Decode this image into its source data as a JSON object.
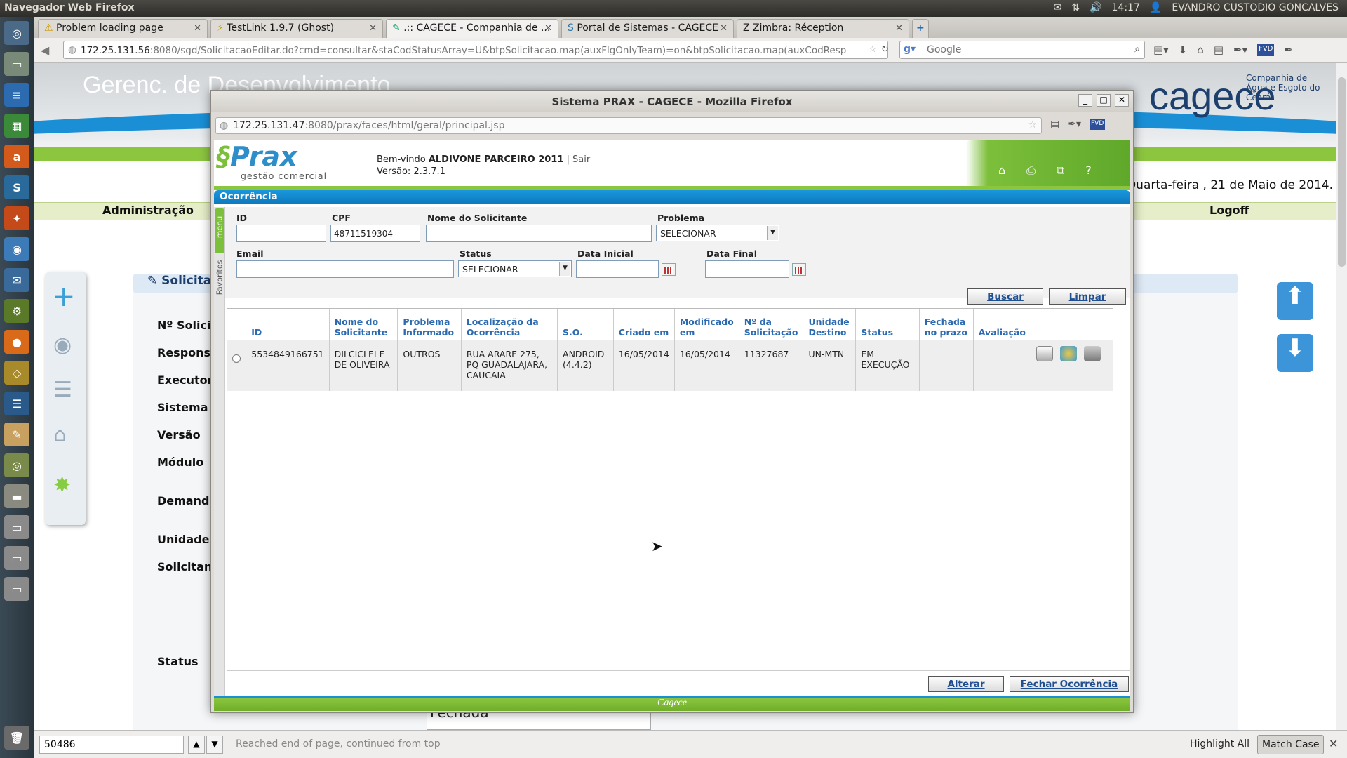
{
  "system": {
    "app_title": "Navegador Web Firefox",
    "clock": "14:17",
    "user": "EVANDRO CUSTODIO GONCALVES"
  },
  "tabs": [
    {
      "label": "Problem loading page"
    },
    {
      "label": "TestLink 1.9.7 (Ghost)"
    },
    {
      "label": ".:: CAGECE - Companhia de ..."
    },
    {
      "label": "Portal de Sistemas - CAGECE"
    },
    {
      "label": "Zimbra: Réception"
    }
  ],
  "browser": {
    "url_host": "172.25.131.56",
    "url_rest": ":8080/sgd/SolicitacaoEditar.do?cmd=consultar&staCodStatusArray=U&btpSolicitacao.map(auxFlgOnlyTeam)=on&btpSolicitacao.map(auxCodResp",
    "search_placeholder": "Google"
  },
  "background": {
    "header_title": "Gerenc. de Desenvolvimento",
    "logo_text": "cagece",
    "logo_sub": "Companhia de Água e Esgoto do Ceará",
    "date": "Quarta-feira , 21 de Maio de 2014.",
    "nav_admin": "Administração",
    "nav_logoff": "Logoff",
    "section": "Solicita",
    "fields": [
      "Nº Solicit",
      "Respons",
      "Executor",
      "Sistema",
      "Versão",
      "Módulo",
      "Demanda",
      "Unidade S",
      "Solicitant",
      "Status"
    ],
    "status_value": "Fechada"
  },
  "popup": {
    "window_title": "Sistema PRAX - CAGECE - Mozilla Firefox",
    "url_host": "172.25.131.47",
    "url_rest": ":8080/prax/faces/html/geral/principal.jsp",
    "brand": "Prax",
    "brand_sub": "gestão comercial",
    "welcome_prefix": "Bem-vindo",
    "welcome_user": "ALDIVONE PARCEIRO 2011",
    "sair": "Sair",
    "version": "Versão: 2.3.7.1",
    "section_title": "Ocorrência",
    "side_menu": "menu",
    "side_fav": "Favoritos",
    "form": {
      "id_label": "ID",
      "id_value": "",
      "cpf_label": "CPF",
      "cpf_value": "48711519304",
      "nome_label": "Nome do Solicitante",
      "nome_value": "",
      "problema_label": "Problema",
      "problema_value": "SELECIONAR",
      "email_label": "Email",
      "email_value": "",
      "status_label": "Status",
      "status_value": "SELECIONAR",
      "data_inicial_label": "Data Inicial",
      "data_inicial_value": "",
      "data_final_label": "Data Final",
      "data_final_value": ""
    },
    "buscar": "Buscar",
    "limpar": "Limpar",
    "columns": [
      "ID",
      "Nome do Solicitante",
      "Problema Informado",
      "Localização da Ocorrência",
      "S.O.",
      "Criado em",
      "Modificado em",
      "Nº da Solicitação",
      "Unidade Destino",
      "Status",
      "Fechada no prazo",
      "Avaliação"
    ],
    "rows": [
      {
        "id": "5534849166751",
        "nome": "DILCICLEI F DE OLIVEIRA",
        "problema": "OUTROS",
        "local": "RUA ARARE 275, PQ GUADALAJARA, CAUCAIA",
        "so": "ANDROID (4.4.2)",
        "criado": "16/05/2014",
        "modificado": "16/05/2014",
        "solicitacao": "11327687",
        "unidade": "UN-MTN",
        "status": "EM EXECUÇÃO",
        "prazo": "",
        "avaliacao": ""
      }
    ],
    "alterar": "Alterar",
    "fechar": "Fechar Ocorrência",
    "footer": "Cagece"
  },
  "findbar": {
    "query": "50486",
    "message": "Reached end of page, continued from top",
    "highlight": "Highlight All",
    "match_case": "Match Case"
  }
}
